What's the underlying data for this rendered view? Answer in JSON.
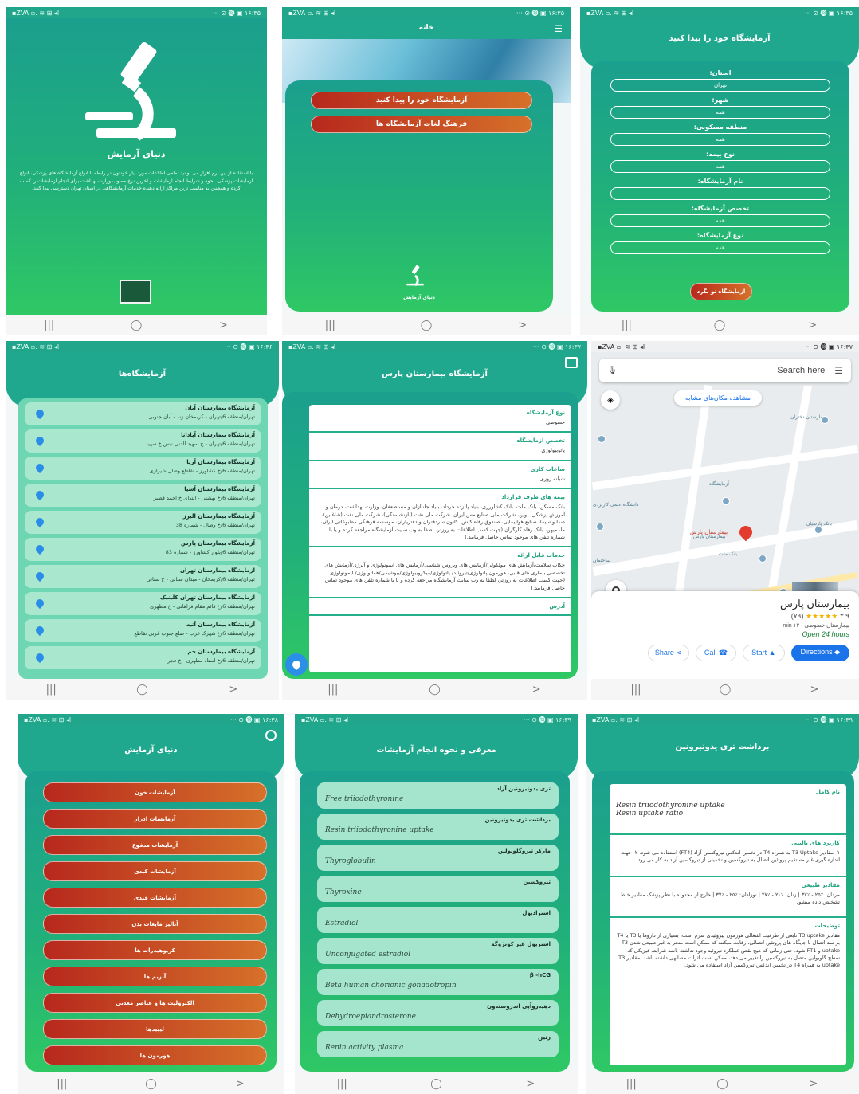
{
  "status": {
    "left": "▪ZVA ▫. ≋ ⊞ ◂l",
    "right_a": "··· ⊙ ⓲ ▣ ١۶:٣۵",
    "right_b": "··· ⊙ ⓲ ▣ ١۶:٣۶",
    "right_c": "··· ⊙ ⓲ ▣ ١۶:٣٧",
    "right_d": "··· ⊙ ⓲ ▣ ١۶:٣٨",
    "right_e": "··· ⊙ ⓲ ▣ ١۶:٣٩"
  },
  "nav": {
    "recent": "|||",
    "home": "◯",
    "back": ">"
  },
  "splash": {
    "title": "دنیای آزمایش",
    "description": "با استفاده از این نرم افزار می توانید تمامی اطلاعات مورد نیاز خودتون در رابطه با انواع آزمایشگاه های پزشکی، انواع آزمایشات پزشکی، نحوه و شرایط انجام آزمایشات و آخرین نرخ مصوب وزارت بهداشت برای انجام آزمایشات را کسب کرده و همچنین به مناسب ترین مراکز ارائه دهنده خدمات آزمایشگاهی در استان تهران دسترسی پیدا کنید."
  },
  "home": {
    "title": "خانه",
    "find_lab": "آزمایشگاه خود را پیدا کنید",
    "lab_culture": "فرهنگ لغات آزمایشگاه ها",
    "logo_caption": "دنیای آزمایش"
  },
  "finder": {
    "title": "آزمایشگاه خود را پیدا کنید",
    "fields": [
      {
        "label": "استان:",
        "value": "تهران"
      },
      {
        "label": "شهر:",
        "value": "همه"
      },
      {
        "label": "منطقه مسکونی:",
        "value": "همه"
      },
      {
        "label": "نوع بیمه:",
        "value": "همه"
      },
      {
        "label": "نام آزمایشگاه:",
        "value": ""
      },
      {
        "label": "تخصص آزمایشگاه:",
        "value": "همه"
      },
      {
        "label": "نوع آزمایشگاه:",
        "value": "همه"
      }
    ],
    "search_button": "آزمایشگاه تو بگرد"
  },
  "labs": {
    "title": "آزمایشگاه‌ها",
    "items": [
      {
        "name": "آزمایشگاه بیمارستان آبان",
        "address": "تهران/منطقه 6/تهران - کریمخان زند - آبان جنوبی"
      },
      {
        "name": "آزمایشگاه بیمارستان آپادانا",
        "address": "تهران/منطقه 6/تهران - خ سهید الدنی نیش خ سهید"
      },
      {
        "name": "آزمایشگاه بیمارستان آریا",
        "address": "تهران/منطقه 6/خ کشاورز - تقاطع وصال شیرازی"
      },
      {
        "name": "آزمایشگاه بیمارستان آسیا",
        "address": "تهران/منطقه 6/خ بهشتی - ابتدای خ احمد قصیر"
      },
      {
        "name": "آزمایشگاه بیمارستان البرز",
        "address": "تهران/منطقه 6/خ وصال - شماره 38"
      },
      {
        "name": "آزمایشگاه بیمارستان پارس",
        "address": "تهران/منطقه 6/بلوار کشاورز - شماره 83"
      },
      {
        "name": "آزمایشگاه بیمارستان تهران",
        "address": "تهران/منطقه 6/کریمخان - میدان سنائی - خ سنائی"
      },
      {
        "name": "آزمایشگاه بیمارستان تهران کلینیک",
        "address": "تهران/منطقه 6/خ قائم مقام فراهانی - خ مطهری"
      },
      {
        "name": "آزمایشگاه بیمارستان آتیه",
        "address": "تهران/منطقه 6/خ شهرک غرب - ضلع جنوب غربی تقاطع"
      },
      {
        "name": "آزمایشگاه بیمارستان جم",
        "address": "تهران/منطقه 6/خ استاد مطهری - خ فجر"
      }
    ]
  },
  "detail": {
    "title": "آزمایشگاه بیمارستان پارس",
    "sections": [
      {
        "h": "نوع آزمایشگاه",
        "p": "خصوصی"
      },
      {
        "h": "تخصص آزمایشگاه",
        "p": "پاتوبیولوژی"
      },
      {
        "h": "ساعات کاری",
        "p": "شبانه روزی"
      },
      {
        "h": "بیمه های طرف قرارداد",
        "p": "بانک مسکن، بانک ملت، بانک کشاورزی، بنیاد پانزده خرداد، بنیاد جانبازان و مستضعفان، وزارت بهداشت، درمان و آموزش پزشکی، نوین، شرکت ملی صنایع مس ایران، شرکت ملی نفت (بازنشستگی)، شرکت ملی نفت (شاغلین)، صدا و سیما، صنایع هواپیمایی، صندوق رفاه کیش، کانون سردفتران و دفتریاران، موسسه فرهنگی مطبوعاتی ایران، ما، میهن، بانک رفاه کارگران (جهت کسب اطلاعات به روزتر، لطفا به وب سایت آزمایشگاه مراجعه کرده و یا با شماره تلفن های موجود تماس حاصل فرمایید.)"
      },
      {
        "h": "خدمات قابل ارائه",
        "p": "چکاپ سلامت/آزمایش های مولکولی/آزمایش های ویروس شناسی/آزمایش های ایمونولوژی و آلرژی/آزمایش های تخصصی بیماری های قلبی، هورمون پاتولوژی/تیروئید/ پاتولوژی/میکروبیولوژی/بیوشیمی/هماتولوژی/ ایمونولوژی (جهت کسب اطلاعات به روزتر، لطفا به وب سایت آزمایشگاه مراجعه کرده و یا با شماره تلفن های موجود تماس حاصل فرمایید.)"
      },
      {
        "h": "آدرس",
        "p": ""
      }
    ]
  },
  "maps": {
    "search_placeholder": "Search here",
    "similar_places": "مشاهده مکان‌های مشابه",
    "place_name": "بیمارستان پارس",
    "rating": "٣.٩",
    "reviews": "(٧٩)",
    "stars": "★★★★★",
    "category": "بیمارستان خصوصی",
    "distance": "١٣ min",
    "hours": "Open 24 hours",
    "marker_label": "بیمارستان پارس",
    "share": "Share",
    "call": "Call",
    "start": "Start",
    "directions": "Directions",
    "pois": [
      "بیمارستان دختران",
      "آزمایشگاه",
      "بیمارستان پارس",
      "بانک ملت",
      "بانک تجارت",
      "بانک سپه",
      "بانک پارسیان",
      "دانشگاه علمی کاربردی",
      "ساختمان"
    ]
  },
  "categories": {
    "title": "دنیای آزمایش",
    "items": [
      "آزمایشات خون",
      "آزمایشات ادرار",
      "آزمایشات مدفوع",
      "آزمایشات کبدی",
      "آزمایشات قندی",
      "آنالیز مایعات بدن",
      "کربوهیدرات ها",
      "آنزیم ها",
      "الکترولیت ها و عناصر معدنی",
      "لیپیدها",
      "هورمون ها"
    ]
  },
  "tests": {
    "title": "معرفی و نحوه انجام آزمایشات",
    "items": [
      {
        "fa": "تری یدوتیرونین آزاد",
        "en": "Free triiodothyronine"
      },
      {
        "fa": "برداشت تری یدوتیرونین",
        "en": "Resin triiodothyronine uptake"
      },
      {
        "fa": "مارکر تیروگلوبولین",
        "en": "Thyroglobulin"
      },
      {
        "fa": "تیروکسین",
        "en": "Thyroxine"
      },
      {
        "fa": "استرادیول",
        "en": "Estradiol"
      },
      {
        "fa": "استریول غیر کونژوگه",
        "en": "Unconjugated estradiol"
      },
      {
        "fa": "β -hCG",
        "en": "Beta human chorionic gonadotropin"
      },
      {
        "fa": "دهیدروآپی اندروستدون",
        "en": "Dehydroepiandrosterone"
      },
      {
        "fa": "رنین",
        "en": "Renin activity plasma"
      }
    ]
  },
  "test_detail": {
    "title": "برداشت تری یدوتیرونین",
    "full_name_h": "نام کامل",
    "full_name_1": "Resin triiodothyronine uptake",
    "full_name_2": "Resin uptake ratio",
    "usage_h": "کاربرد های بالینی",
    "usage_p": "۱- مقادیر T3 Uptake به همراه T4 در تخمین اندکس تیروکسین آزاد (FT4) استفاده می شود. ۲- جهت اندازه گیری غیر مستقیم پروتئین اتصال به تیروکسین و تخمینی از تیروکسین آزاد به کار می رود",
    "normal_h": "مقادیر طبیعی",
    "normal_p": "مردان: ٪۲۵ - ٪۳۷ | زنان: ٪۲۰ - ٪۲۷ | نوزادان: ٪۲۵ - ٪۳۷ | خارج از محدوده با نظر پزشک مقادیر خلط تشخیص داده میشود",
    "notes_h": "توضیحات",
    "notes_p": "مقادیر T3 uptake تابعی از ظرفیت اشغالی هورمون تیروئیدی سرم است، بسیاری از داروها یا T3 یا T4 بر سد اتصال با جایگاه های پروتئین اتصالی، رقابت میکنند که ممکن است منجر به غیر طبیعی شدن T3 uptake و FT1 شود. حتی زمانی که هیچ نقص عملکرد تیروئید وجود نداشته باشد شرایط فیزیکی که سطح گلوبولین متصل به تیروکسین را تغییر می دهد، ممکن است اثرات مشابهی داشته باشد. مقادیر T3 uptake به همراه T4 در تخمین اندکس تیروکسین آزاد استفاده می شود."
  },
  "colors": {
    "primary": "#1fa88e",
    "accent_orange": "#d6712a",
    "accent_red": "#b7281d",
    "link_blue": "#1a73e8"
  }
}
